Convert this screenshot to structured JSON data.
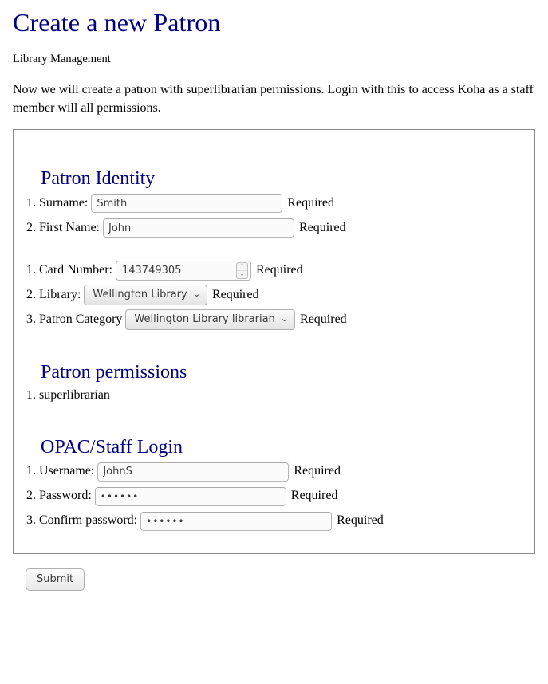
{
  "page": {
    "title": "Create a new Patron",
    "subtitle": "Library Management",
    "intro": "Now we will create a patron with superlibrarian permissions. Login with this to access Koha as a staff member will all permissions."
  },
  "identity": {
    "heading": "Patron Identity",
    "fields": [
      {
        "label": "Surname:",
        "value": "Smith",
        "note": "Required"
      },
      {
        "label": "First Name:",
        "value": "John",
        "note": "Required"
      }
    ],
    "fields2": [
      {
        "label": "Card Number:",
        "value": "143749305",
        "note": "Required"
      },
      {
        "label": "Library:",
        "value": "Wellington Library",
        "note": "Required"
      },
      {
        "label": "Patron Category",
        "value": "Wellington Library librarian",
        "note": "Required"
      }
    ]
  },
  "permissions": {
    "heading": "Patron permissions",
    "items": [
      {
        "label": "superlibrarian"
      }
    ]
  },
  "login": {
    "heading": "OPAC/Staff Login",
    "fields": [
      {
        "label": "Username:",
        "value": "JohnS",
        "note": "Required"
      },
      {
        "label": "Password:",
        "value": "••••••",
        "note": "Required"
      },
      {
        "label": "Confirm password:",
        "value": "••••••",
        "note": "Required"
      }
    ]
  },
  "icons": {
    "spinner_up": "⌃",
    "spinner_down": "⌄",
    "chevron_down": "⌄"
  },
  "actions": {
    "submit_label": "Submit"
  },
  "colors": {
    "heading": "#000080",
    "border": "#888c8e",
    "field_bg": "#fbfbfb"
  }
}
